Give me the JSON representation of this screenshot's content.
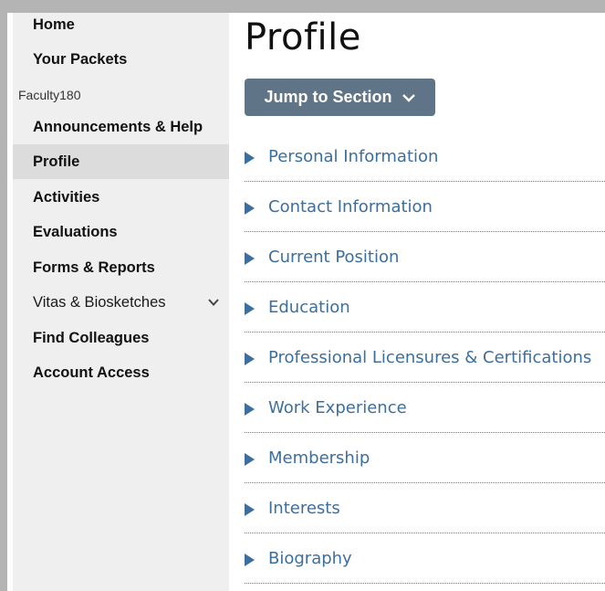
{
  "page": {
    "title": "Profile"
  },
  "sidebar": {
    "top_items": [
      {
        "label": "Home"
      },
      {
        "label": "Your Packets"
      }
    ],
    "group_label": "Faculty180",
    "items": [
      {
        "label": "Announcements & Help"
      },
      {
        "label": "Profile",
        "active": true
      },
      {
        "label": "Activities"
      },
      {
        "label": "Evaluations"
      },
      {
        "label": "Forms & Reports"
      },
      {
        "label": "Vitas & Biosketches",
        "expandable": true
      },
      {
        "label": "Find Colleagues"
      },
      {
        "label": "Account Access"
      }
    ]
  },
  "jump": {
    "label": "Jump to Section"
  },
  "sections": [
    {
      "label": "Personal Information"
    },
    {
      "label": "Contact Information"
    },
    {
      "label": "Current Position"
    },
    {
      "label": "Education"
    },
    {
      "label": "Professional Licensures & Certifications"
    },
    {
      "label": "Work Experience"
    },
    {
      "label": "Membership"
    },
    {
      "label": "Interests"
    },
    {
      "label": "Biography"
    }
  ],
  "colors": {
    "accent": "#3c6e9e",
    "button_bg": "#5f7587",
    "sidebar_bg": "#efefef",
    "sidebar_active": "#dcdcdc"
  },
  "icons": {
    "jump_chevron": "chevron-down-icon",
    "vitas_chevron": "chevron-down-icon",
    "section_toggle": "caret-right-icon"
  }
}
